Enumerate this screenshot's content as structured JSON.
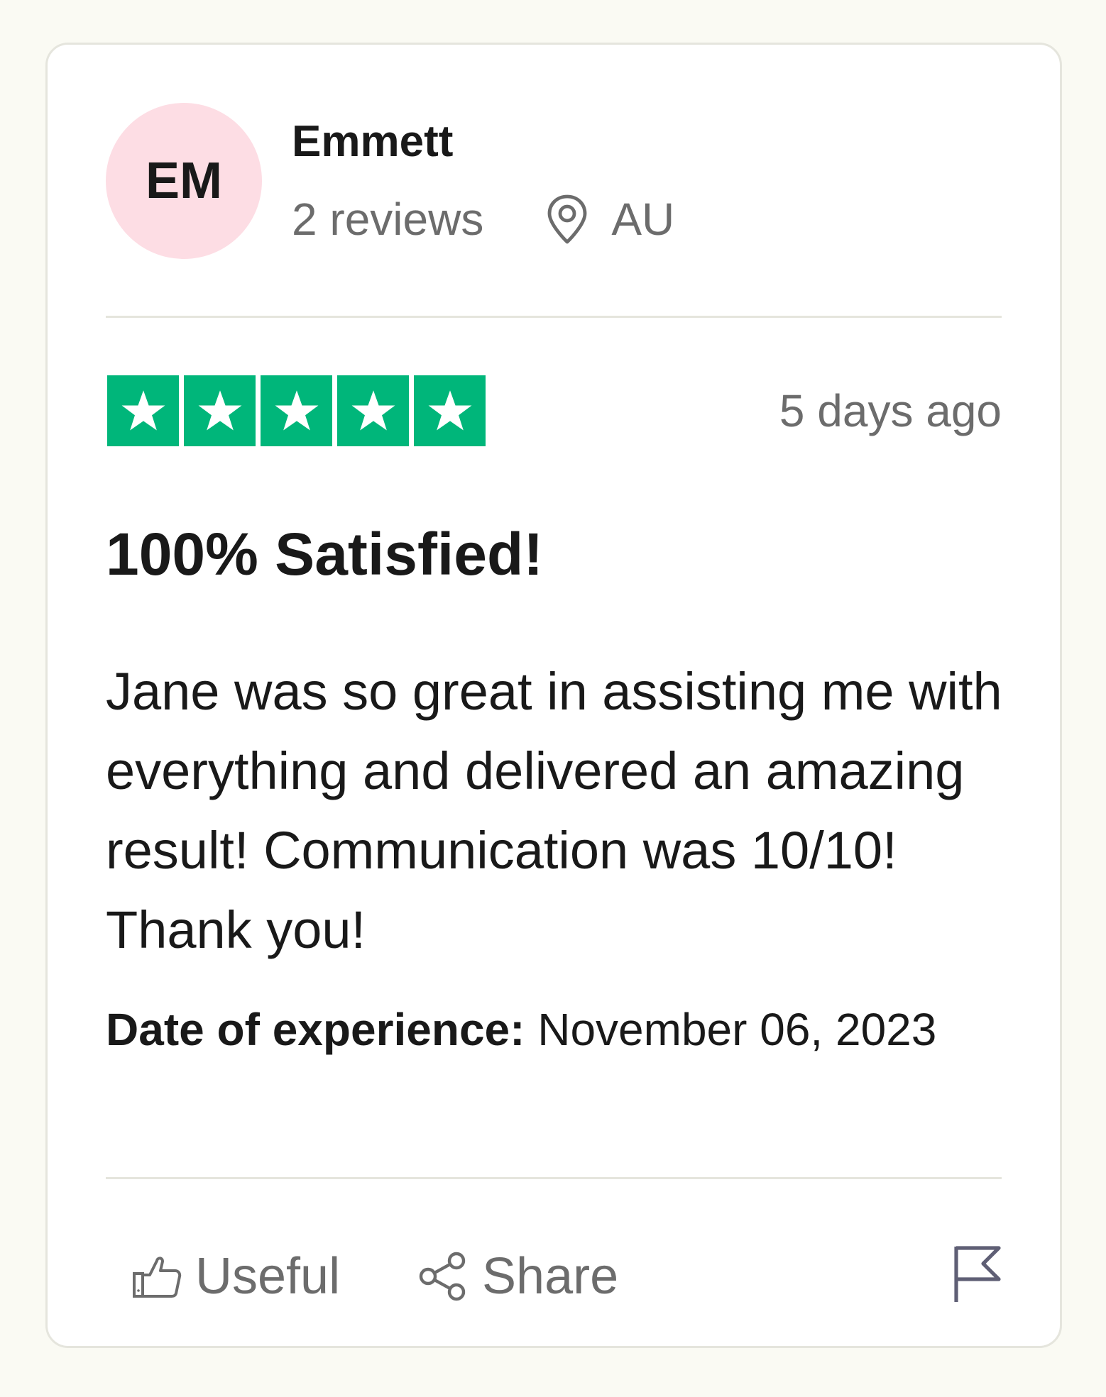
{
  "reviewer": {
    "initials": "EM",
    "name": "Emmett",
    "review_count": "2 reviews",
    "country": "AU",
    "avatar_color": "#fddde4"
  },
  "review": {
    "rating": 5,
    "rating_max": 5,
    "star_color": "#00b67a",
    "posted": "5 days ago",
    "title": "100% Satisfied!",
    "body": "Jane was so great in assisting me with everything and delivered an amazing result! Communication was 10/10! Thank you!",
    "experience_label": "Date of experience:",
    "experience_date": "November 06, 2023"
  },
  "actions": {
    "useful_label": "Useful",
    "share_label": "Share"
  },
  "icons": {
    "location": "location-pin-icon",
    "useful": "thumbs-up-icon",
    "share": "share-icon",
    "report": "flag-icon",
    "star": "star-icon"
  }
}
